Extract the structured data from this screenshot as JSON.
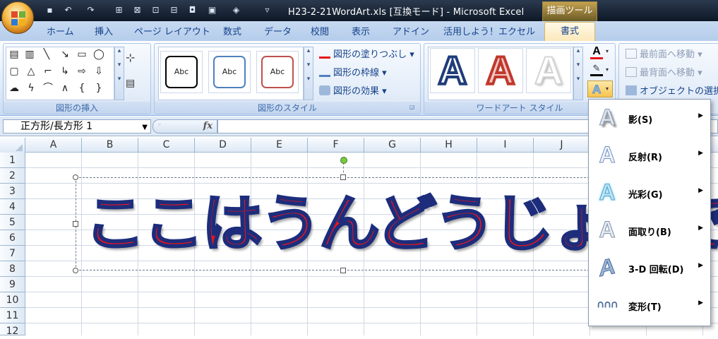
{
  "window": {
    "title": "H23-2-21WordArt.xls [互換モード] - Microsoft Excel",
    "context_tab": "描画ツール"
  },
  "ribbon_tabs": [
    "ホーム",
    "挿入",
    "ページ レイアウト",
    "数式",
    "データ",
    "校閲",
    "表示",
    "アドイン",
    "活用しよう！エクセル",
    "書式"
  ],
  "groups": {
    "insert_shapes": "図形の挿入",
    "shape_styles": "図形のスタイル",
    "wordart_styles": "ワードアート スタイル"
  },
  "shape_style_samples": [
    "Abc",
    "Abc",
    "Abc"
  ],
  "shape_commands": {
    "fill": "図形の塗りつぶし",
    "outline": "図形の枠線",
    "effects": "図形の効果"
  },
  "wordart_samples": [
    "A",
    "A",
    "A"
  ],
  "arrange": {
    "bring_front": "最前面へ移動",
    "send_back": "最背面へ移動",
    "selection_pane": "オブジェクトの選択と"
  },
  "formula_bar": {
    "name_box": "正方形/長方形 1",
    "fx": "fx"
  },
  "columns": [
    "A",
    "B",
    "C",
    "D",
    "E",
    "F",
    "G",
    "H",
    "I",
    "J"
  ],
  "rows": [
    "1",
    "2",
    "3",
    "4",
    "5",
    "6",
    "7",
    "8",
    "9",
    "10",
    "11",
    "12"
  ],
  "wordart_text": "ここはうんどうじょうで",
  "effects_menu": [
    {
      "label": "影(S)",
      "icon": "shadow-effect-icon"
    },
    {
      "label": "反射(R)",
      "icon": "reflection-effect-icon"
    },
    {
      "label": "光彩(G)",
      "icon": "glow-effect-icon"
    },
    {
      "label": "面取り(B)",
      "icon": "bevel-effect-icon"
    },
    {
      "label": "3-D 回転(D)",
      "icon": "3d-rotation-effect-icon"
    },
    {
      "label": "変形(T)",
      "icon": "transform-effect-icon"
    }
  ],
  "colors": {
    "wordart_fill": "#e8141c",
    "wordart_outline": "#1d2d7c",
    "ribbon_text": "#15428b"
  }
}
